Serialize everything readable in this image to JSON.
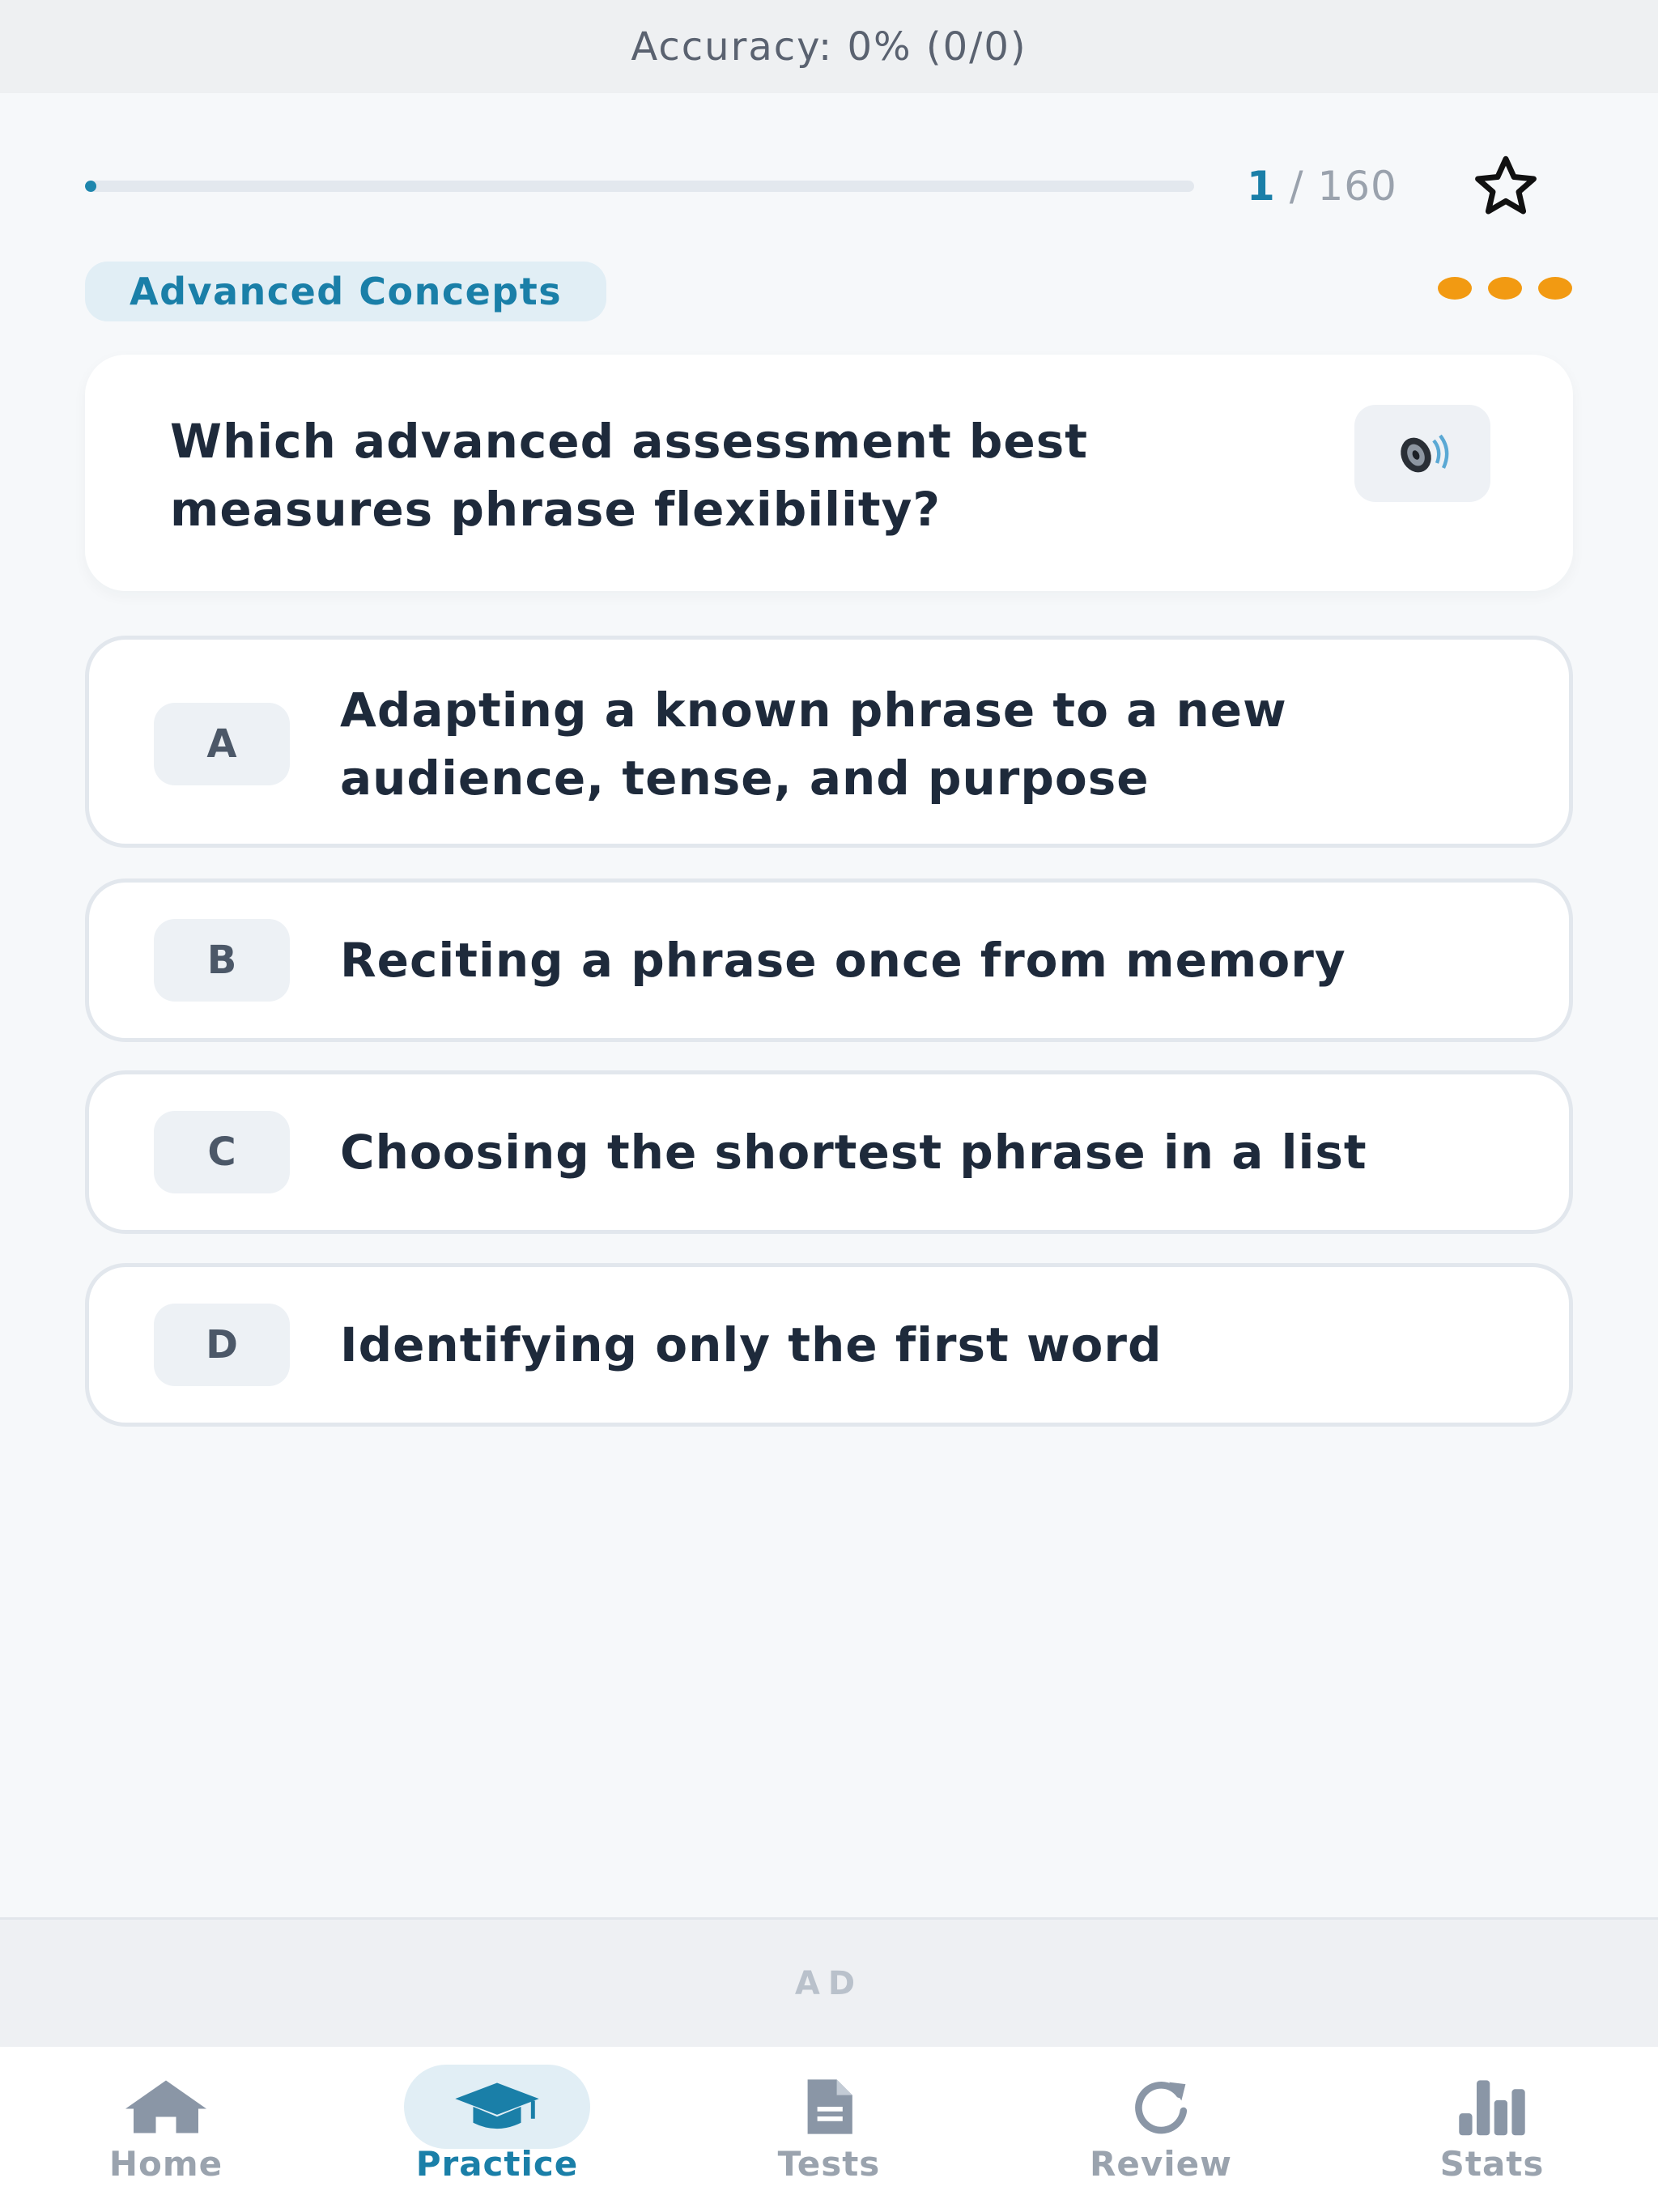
{
  "header": {
    "accuracy_text": "Accuracy: 0% (0/0)"
  },
  "progress": {
    "current": "1",
    "separator": " / ",
    "total": "160",
    "fraction": 0.00625
  },
  "category": {
    "label": "Advanced Concepts"
  },
  "question": {
    "text": "Which advanced assessment best measures phrase flexibility?"
  },
  "options": [
    {
      "letter": "A",
      "text": "Adapting a known phrase to a new audience, tense, and purpose"
    },
    {
      "letter": "B",
      "text": "Reciting a phrase once from memory"
    },
    {
      "letter": "C",
      "text": "Choosing the shortest phrase in a list"
    },
    {
      "letter": "D",
      "text": "Identifying only the first word"
    }
  ],
  "ad": {
    "label": "AD"
  },
  "tabs": [
    {
      "label": "Home",
      "icon": "home-icon",
      "active": false
    },
    {
      "label": "Practice",
      "icon": "graduation-cap-icon",
      "active": true
    },
    {
      "label": "Tests",
      "icon": "document-icon",
      "active": false
    },
    {
      "label": "Review",
      "icon": "refresh-icon",
      "active": false
    },
    {
      "label": "Stats",
      "icon": "bar-chart-icon",
      "active": false
    }
  ],
  "colors": {
    "accent": "#1a7fa8",
    "dots": "#f29a12",
    "inactive_tab": "#9aa3ae"
  }
}
